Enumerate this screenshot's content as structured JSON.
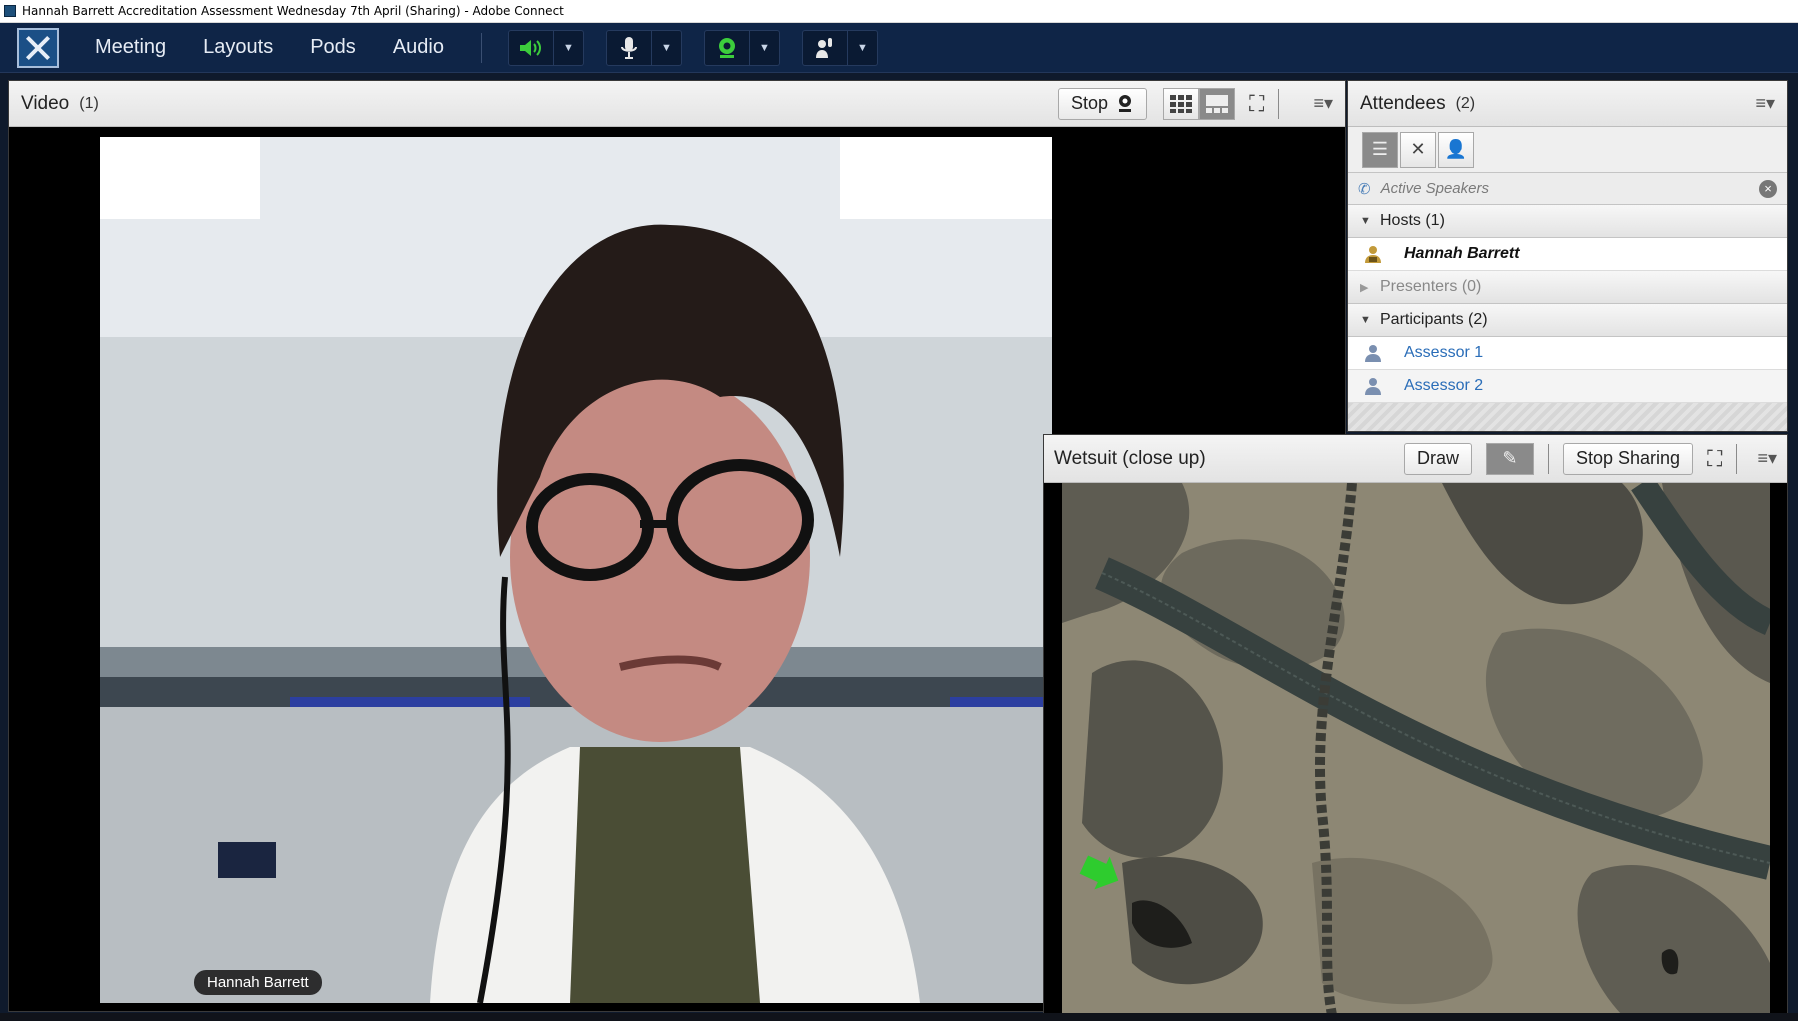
{
  "window": {
    "title": "Hannah Barrett Accreditation Assessment Wednesday 7th April (Sharing) - Adobe Connect"
  },
  "menu": {
    "items": [
      "Meeting",
      "Layouts",
      "Pods",
      "Audio"
    ]
  },
  "controls": {
    "speaker_icon": "speaker-icon",
    "mic_icon": "microphone-icon",
    "camera_icon": "webcam-icon",
    "raise_hand_icon": "raise-hand-icon"
  },
  "video_pod": {
    "title": "Video",
    "count": "(1)",
    "stop_label": "Stop",
    "speaker_name": "Hannah Barrett"
  },
  "attendees_pod": {
    "title": "Attendees",
    "count": "(2)",
    "active_speakers": "Active Speakers",
    "hosts_label": "Hosts (1)",
    "hosts": [
      "Hannah Barrett"
    ],
    "presenters_label": "Presenters (0)",
    "participants_label": "Participants (2)",
    "participants": [
      "Assessor 1",
      "Assessor 2"
    ]
  },
  "share_pod": {
    "title": "Wetsuit (close up)",
    "draw_label": "Draw",
    "stop_sharing_label": "Stop Sharing"
  },
  "colors": {
    "menubar": "#0f2547",
    "participant_link": "#2a6db8",
    "green_status": "#3ccd3c"
  }
}
